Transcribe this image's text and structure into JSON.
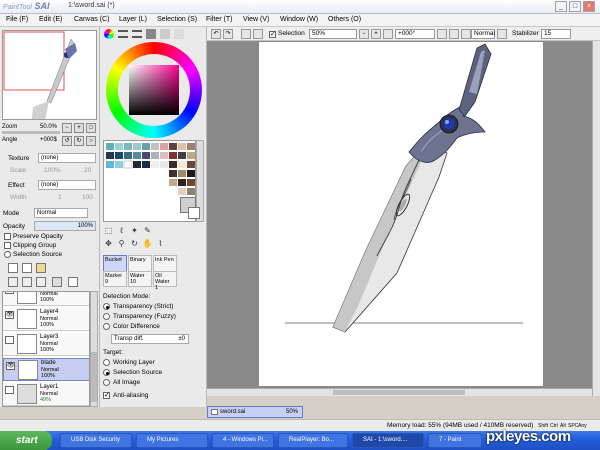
{
  "app": {
    "logo_small": "PaintTool",
    "logo": "SAI",
    "title": "1:\\sword.sai (*)"
  },
  "window_buttons": [
    "_",
    "□",
    "×"
  ],
  "menu": [
    {
      "label": "File (F)"
    },
    {
      "label": "Edit (E)"
    },
    {
      "label": "Canvas (C)"
    },
    {
      "label": "Layer (L)"
    },
    {
      "label": "Selection (S)"
    },
    {
      "label": "Filter (T)"
    },
    {
      "label": "View (V)"
    },
    {
      "label": "Window (W)"
    },
    {
      "label": "Others (O)"
    }
  ],
  "navigator": {
    "zoom_label": "Zoom",
    "zoom_value": "50.0%",
    "angle_label": "Angle",
    "angle_value": "+000$"
  },
  "texture": {
    "label": "Texture",
    "value": "(none)",
    "scale_label": "Scale",
    "scale_value": "100%",
    "scale_num": "20"
  },
  "effect": {
    "label": "Effect",
    "value": "(none)",
    "width_label": "Width",
    "width_value": "1",
    "width_num": "100"
  },
  "layer_props": {
    "mode_label": "Mode",
    "mode_value": "Normal",
    "opacity_label": "Opacity",
    "opacity_value": "100%",
    "preserve_opacity": "Preserve Opacity",
    "clipping_group": "Clipping Group",
    "selection_source": "Selection Source"
  },
  "layers": [
    {
      "name": "",
      "mode": "Normal",
      "opacity": "100%"
    },
    {
      "name": "Layer4",
      "mode": "Normal",
      "opacity": "100%"
    },
    {
      "name": "Layer3",
      "mode": "Normal",
      "opacity": "100%"
    },
    {
      "name": "blade",
      "mode": "Normal",
      "opacity": "100%"
    },
    {
      "name": "Layer1",
      "mode": "Normal",
      "opacity": "49%"
    }
  ],
  "brushes": [
    {
      "name": "Bucket",
      "size": ""
    },
    {
      "name": "Binary",
      "size": ""
    },
    {
      "name": "Ink Pen",
      "size": ""
    },
    {
      "name": "Marker",
      "size": "9"
    },
    {
      "name": "Water",
      "size": "10"
    },
    {
      "name": "Oil Water",
      "size": "1"
    }
  ],
  "detection": {
    "title": "Detection Mode:",
    "opts": [
      "Transparency (Strict)",
      "Transparency (Fuzzy)",
      "Color Difference"
    ],
    "transp_label": "Transp diff.",
    "transp_value": "±0",
    "target_title": "Target:",
    "targets": [
      "Working Layer",
      "Selection Source",
      "All Image"
    ],
    "antialias": "Anti-aliasing"
  },
  "canvas_toolbar": {
    "selection": "Selection",
    "zoom": "50%",
    "angle": "+000°",
    "mode": "Normal",
    "stabilizer_label": "Stabilizer",
    "stabilizer_value": "15"
  },
  "file_tab": {
    "name": "sword.sai",
    "zoom": "50%"
  },
  "status": {
    "memory": "Memory load: 55% (94MB used / 410MB reserved)",
    "keys": [
      "Shift",
      "Ctrl",
      "Alt",
      "SPC",
      "Any"
    ]
  },
  "taskbar": {
    "start": "start",
    "tasks": [
      {
        "label": "USB Disk Security"
      },
      {
        "label": "My Pictures"
      },
      {
        "label": "4 - Windows Pi..."
      },
      {
        "label": "RealPlayer: Bo..."
      },
      {
        "label": "SAI - 1:\\sword...."
      },
      {
        "label": "7 - Paint"
      }
    ]
  },
  "watermark": "pxleyes.com"
}
